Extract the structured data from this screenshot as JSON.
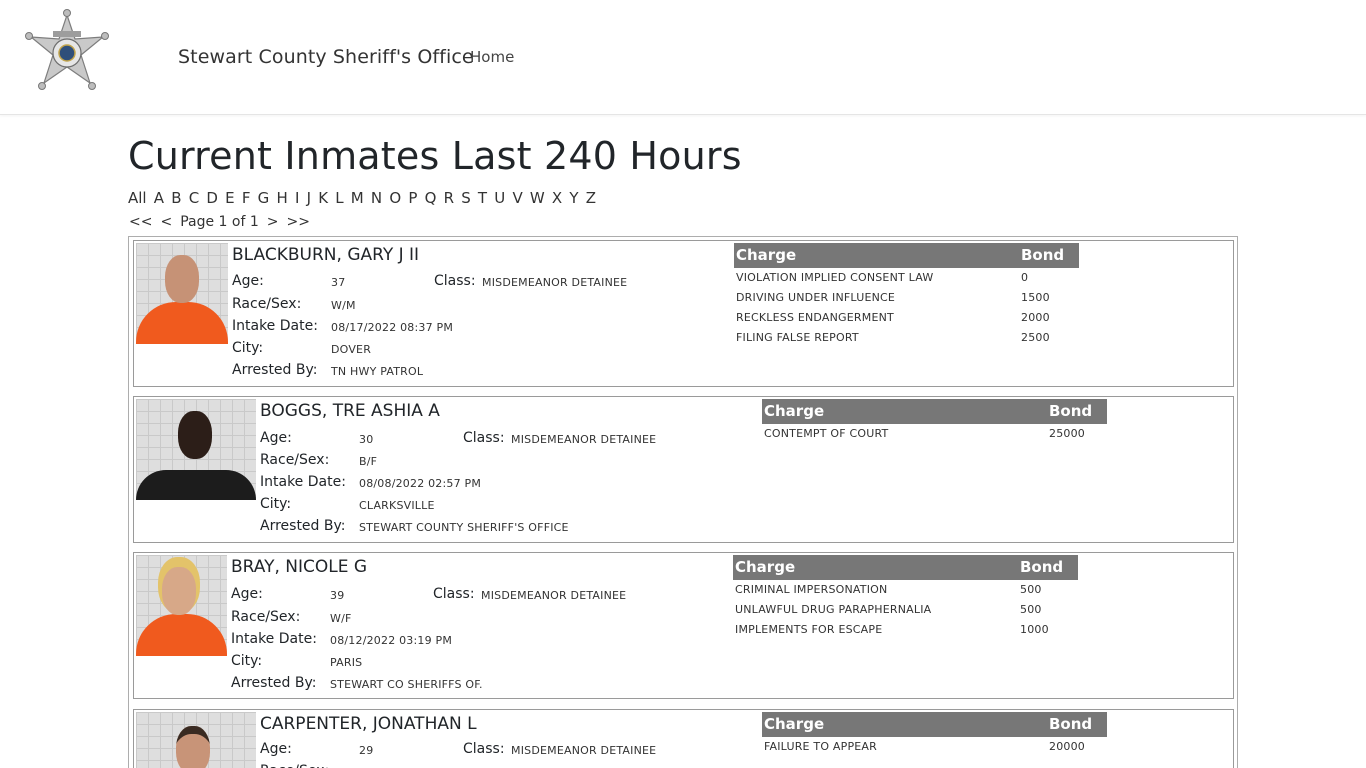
{
  "nav": {
    "brand": "Stewart County Sheriff's Office",
    "home": "Home"
  },
  "page": {
    "title": "Current Inmates Last 240 Hours"
  },
  "alphabet": [
    "All",
    "A",
    "B",
    "C",
    "D",
    "E",
    "F",
    "G",
    "H",
    "I",
    "J",
    "K",
    "L",
    "M",
    "N",
    "O",
    "P",
    "Q",
    "R",
    "S",
    "T",
    "U",
    "V",
    "W",
    "X",
    "Y",
    "Z"
  ],
  "pager": {
    "first": "<<",
    "prev": "<",
    "info": "Page 1 of 1",
    "next": ">",
    "last": ">>"
  },
  "labels": {
    "age": "Age:",
    "race_sex": "Race/Sex:",
    "intake": "Intake Date:",
    "city": "City:",
    "arrested_by": "Arrested By:",
    "class": "Class:",
    "charge": "Charge",
    "bond": "Bond"
  },
  "inmates": [
    {
      "name": "BLACKBURN, GARY J II",
      "age": "37",
      "race_sex": "W/M",
      "intake": "08/17/2022 08:37 PM",
      "city": "DOVER",
      "arrested_by": "TN HWY PATROL",
      "class": "MISDEMEANOR DETAINEE",
      "charges": [
        {
          "charge": "VIOLATION IMPLIED CONSENT LAW",
          "bond": "0"
        },
        {
          "charge": "DRIVING UNDER INFLUENCE",
          "bond": "1500"
        },
        {
          "charge": "RECKLESS ENDANGERMENT",
          "bond": "2000"
        },
        {
          "charge": "FILING FALSE REPORT",
          "bond": "2500"
        }
      ]
    },
    {
      "name": "BOGGS, TRE ASHIA A",
      "age": "30",
      "race_sex": "B/F",
      "intake": "08/08/2022 02:57 PM",
      "city": "CLARKSVILLE",
      "arrested_by": "STEWART COUNTY SHERIFF'S OFFICE",
      "class": "MISDEMEANOR DETAINEE",
      "charges": [
        {
          "charge": "CONTEMPT OF COURT",
          "bond": "25000"
        }
      ]
    },
    {
      "name": "BRAY, NICOLE G",
      "age": "39",
      "race_sex": "W/F",
      "intake": "08/12/2022 03:19 PM",
      "city": "PARIS",
      "arrested_by": "STEWART CO SHERIFFS OF.",
      "class": "MISDEMEANOR DETAINEE",
      "charges": [
        {
          "charge": "CRIMINAL IMPERSONATION",
          "bond": "500"
        },
        {
          "charge": "UNLAWFUL DRUG PARAPHERNALIA",
          "bond": "500"
        },
        {
          "charge": "IMPLEMENTS FOR ESCAPE",
          "bond": "1000"
        }
      ]
    },
    {
      "name": "CARPENTER, JONATHAN L",
      "age": "29",
      "race_sex": "",
      "intake": "",
      "city": "",
      "arrested_by": "",
      "class": "MISDEMEANOR DETAINEE",
      "charges": [
        {
          "charge": "FAILURE TO APPEAR",
          "bond": "20000"
        }
      ]
    }
  ],
  "colors": {
    "header_bg": "#777777",
    "jumpsuit": "#f05a1e",
    "card_border": "#9a9a9a"
  }
}
